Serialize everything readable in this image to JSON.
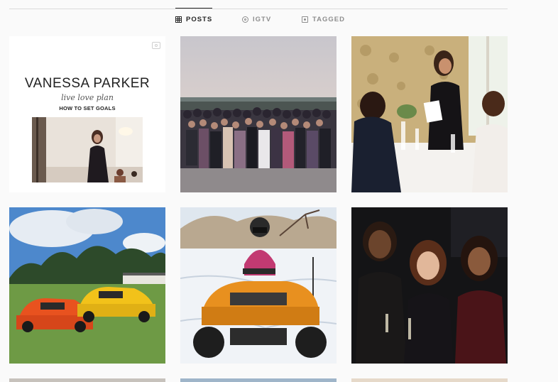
{
  "tabs": [
    {
      "label": "POSTS",
      "icon": "grid-icon",
      "active": true
    },
    {
      "label": "IGTV",
      "icon": "tv-icon",
      "active": false
    },
    {
      "label": "TAGGED",
      "icon": "tag-icon",
      "active": false
    }
  ],
  "posts": {
    "goal_post": {
      "name": "VANESSA PARKER",
      "script": "live love plan",
      "topic": "HOW TO SET GOALS"
    }
  },
  "colors": {
    "background": "#fafafa",
    "active_tab": "#262626",
    "inactive_tab": "#8e8e8e",
    "divider": "#dbdbdb"
  }
}
